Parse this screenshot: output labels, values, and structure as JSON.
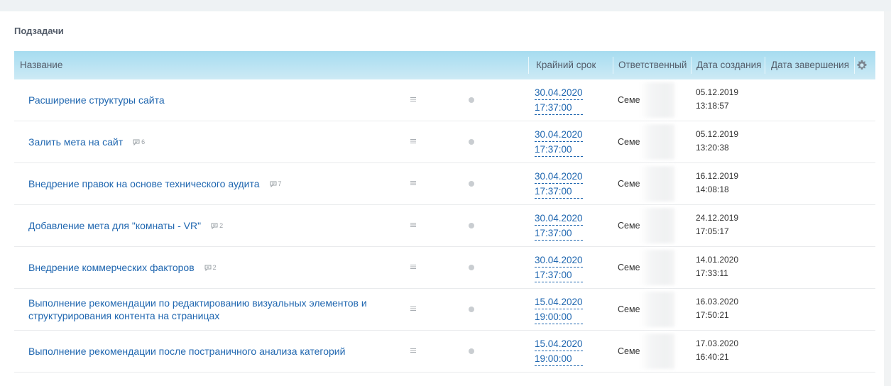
{
  "section_title": "Подзадачи",
  "columns": {
    "name": "Название",
    "deadline": "Крайний срок",
    "responsible": "Ответственный",
    "created": "Дата создания",
    "completed": "Дата завершения"
  },
  "icons": {
    "settings": "gear-icon",
    "row_menu": "menu-lines-icon",
    "status": "status-dot-icon",
    "comments": "comment-icon"
  },
  "colors": {
    "link": "#2067b0",
    "header_bg": "#bfe6f4"
  },
  "rows": [
    {
      "title": "Расширение структуры сайта",
      "comments": "",
      "deadline_date": "30.04.2020",
      "deadline_time": "17:37:00",
      "responsible": "Семе",
      "created_date": "05.12.2019",
      "created_time": "13:18:57"
    },
    {
      "title": "Залить мета на сайт",
      "comments": "6",
      "deadline_date": "30.04.2020",
      "deadline_time": "17:37:00",
      "responsible": "Семе",
      "created_date": "05.12.2019",
      "created_time": "13:20:38"
    },
    {
      "title": "Внедрение правок на основе технического аудита",
      "comments": "7",
      "deadline_date": "30.04.2020",
      "deadline_time": "17:37:00",
      "responsible": "Семе",
      "created_date": "16.12.2019",
      "created_time": "14:08:18"
    },
    {
      "title": "Добавление мета для \"комнаты - VR\"",
      "comments": "2",
      "deadline_date": "30.04.2020",
      "deadline_time": "17:37:00",
      "responsible": "Семе",
      "created_date": "24.12.2019",
      "created_time": "17:05:17"
    },
    {
      "title": "Внедрение коммерческих факторов",
      "comments": "2",
      "deadline_date": "30.04.2020",
      "deadline_time": "17:37:00",
      "responsible": "Семе",
      "created_date": "14.01.2020",
      "created_time": "17:33:11"
    },
    {
      "title": "Выполнение рекомендации по редактированию визуальных элементов и структурирования контента на страницах",
      "comments": "",
      "deadline_date": "15.04.2020",
      "deadline_time": "19:00:00",
      "responsible": "Семе",
      "created_date": "16.03.2020",
      "created_time": "17:50:21"
    },
    {
      "title": "Выполнение рекомендации после постраничного анализа категорий",
      "comments": "",
      "deadline_date": "15.04.2020",
      "deadline_time": "19:00:00",
      "responsible": "Семе",
      "created_date": "17.03.2020",
      "created_time": "16:40:21"
    }
  ]
}
